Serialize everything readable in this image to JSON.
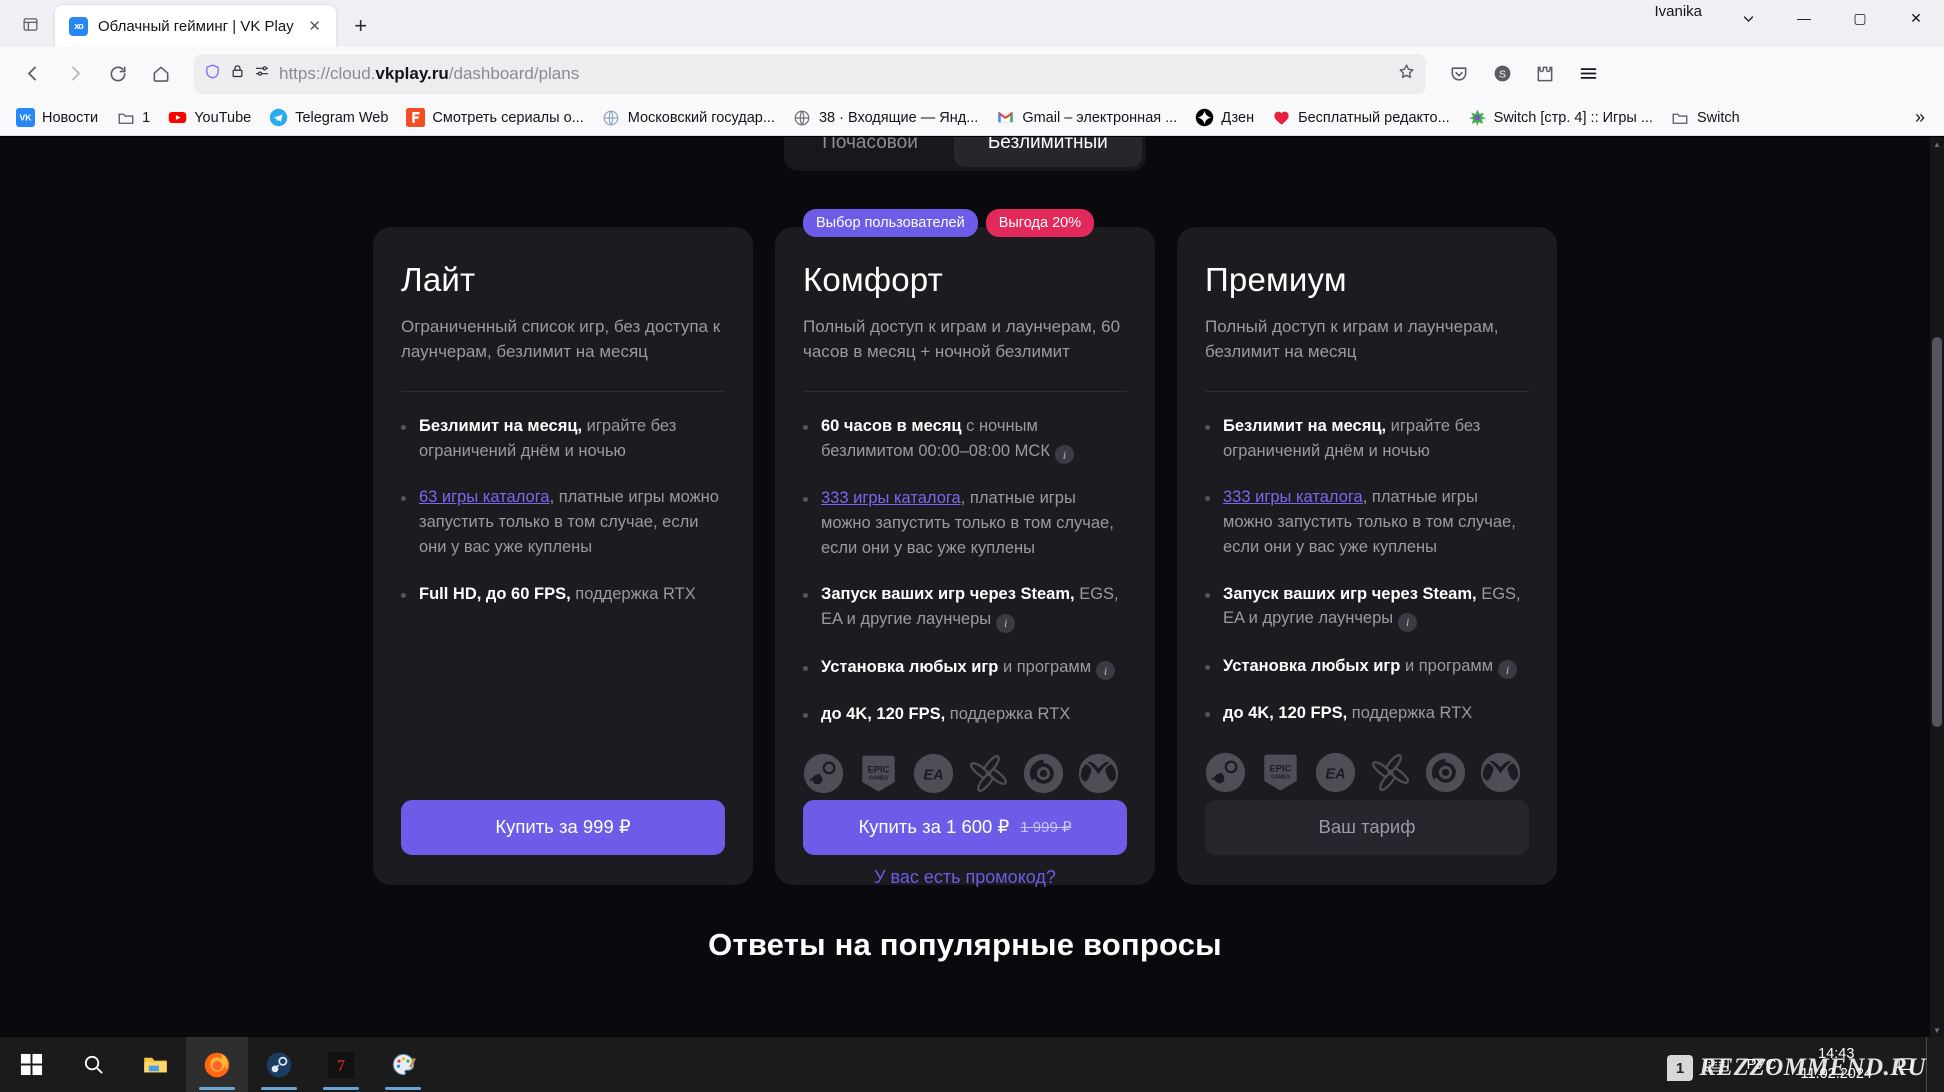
{
  "browser": {
    "tab": {
      "title": "Облачный гейминг | VK Play",
      "favicon_label": "vk",
      "close_icon": "close-icon"
    },
    "newtab_label": "+",
    "window_user": "Ivanika",
    "window_controls": {
      "minimize": "—",
      "maximize": "▢",
      "close": "✕"
    },
    "list_tabs_icon": "list-all-tabs-icon",
    "nav": {
      "back_icon": "back-arrow-icon",
      "forward_icon": "forward-arrow-icon",
      "reload_icon": "reload-icon",
      "home_icon": "home-icon",
      "shield_icon": "shield-icon",
      "lock_icon": "lock-icon",
      "permissions_icon": "page-permissions-icon",
      "bookmark_star_icon": "bookmark-star-icon",
      "pocket_icon": "pocket-icon",
      "account_icon": "account-icon",
      "extensions_icon": "extensions-icon",
      "menu_icon": "hamburger-menu-icon"
    },
    "url": {
      "scheme": "https://cloud.",
      "domain": "vkplay.ru",
      "path": "/dashboard/plans"
    },
    "bookmarks": [
      {
        "label": "Новости",
        "icon": "vk-icon",
        "color": "#2787f5"
      },
      {
        "label": "1",
        "icon": "folder-icon",
        "color": "#5b5b66"
      },
      {
        "label": "YouTube",
        "icon": "youtube-icon",
        "color": "#ff0000"
      },
      {
        "label": "Telegram Web",
        "icon": "telegram-icon",
        "color": "#2aabee"
      },
      {
        "label": "Смотреть сериалы о...",
        "icon": "filmix-icon",
        "color": "#f04e23"
      },
      {
        "label": "Московский государ...",
        "icon": "globe-icon",
        "color": "#8fa6c0"
      },
      {
        "label": "38 · Входящие — Янд...",
        "icon": "globe-icon",
        "color": "#6f6f78"
      },
      {
        "label": "Gmail – электронная ...",
        "icon": "gmail-icon",
        "color": "#ea4335"
      },
      {
        "label": "Дзен",
        "icon": "dzen-icon",
        "color": "#000000"
      },
      {
        "label": "Бесплатный редакто...",
        "icon": "heart-icon",
        "color": "#e8213f"
      },
      {
        "label": "Switch [стр. 4] :: Игры ...",
        "icon": "switch-icon",
        "color": "#46b04a"
      },
      {
        "label": "Switch",
        "icon": "folder-icon",
        "color": "#5b5b66"
      }
    ],
    "bookmarks_overflow_icon": "chevron-double-right-icon"
  },
  "page": {
    "billing_tabs": [
      {
        "label": "Почасовой",
        "active": false
      },
      {
        "label": "Безлимитный",
        "active": true
      }
    ],
    "promo_link": "У вас есть промокод?",
    "faq_heading": "Ответы на популярные вопросы",
    "colors": {
      "accent": "#6c5ce7",
      "badge_sale": "#e3285a",
      "card_bg": "#1b1b20",
      "page_bg": "#0a0a0e"
    },
    "launcher_icons": [
      "steam-icon",
      "epic-games-icon",
      "ea-icon",
      "battlenet-icon",
      "ubisoft-icon",
      "xbox-icon"
    ],
    "plans": [
      {
        "title": "Лайт",
        "subtitle": "Ограниченный список игр, без доступа к лаунчерам, безлимит на месяц",
        "badges": [],
        "features": [
          {
            "strong": "Безлимит на месяц,",
            "rest": " играйте без ограничений днём и ночью",
            "link": "",
            "info": false
          },
          {
            "strong": "",
            "link": "63 игры каталога",
            "rest": ", платные игры можно запустить только в том случае, если они у вас уже куплены",
            "info": false
          },
          {
            "strong": "Full HD, до 60 FPS,",
            "rest": " поддержка RTX",
            "link": "",
            "info": false
          }
        ],
        "has_launchers": false,
        "cta": {
          "label": "Купить за 999 ₽",
          "old_price": "",
          "style": "primary"
        }
      },
      {
        "title": "Комфорт",
        "subtitle": "Полный доступ к играм и лаунчерам, 60 часов в месяц + ночной безлимит",
        "badges": [
          {
            "label": "Выбор пользователей",
            "color": "#6c5ce7"
          },
          {
            "label": "Выгода 20%",
            "color": "#e3285a"
          }
        ],
        "features": [
          {
            "strong": "60 часов в месяц",
            "rest": " с ночным безлимитом 00:00–08:00 МСК",
            "link": "",
            "info": true
          },
          {
            "strong": "",
            "link": "333 игры каталога",
            "rest": ", платные игры можно запустить только в том случае, если они у вас уже куплены",
            "info": false
          },
          {
            "strong": "Запуск ваших игр через Steam,",
            "rest": " EGS, EA и другие лаунчеры",
            "link": "",
            "info": true
          },
          {
            "strong": "Установка любых игр",
            "rest": " и программ",
            "link": "",
            "info": true
          },
          {
            "strong": "до 4K, 120 FPS,",
            "rest": " поддержка RTX",
            "link": "",
            "info": false
          }
        ],
        "has_launchers": true,
        "cta": {
          "label": "Купить за 1 600 ₽",
          "old_price": "1 999 ₽",
          "style": "primary"
        }
      },
      {
        "title": "Премиум",
        "subtitle": "Полный доступ к играм и лаунчерам, безлимит на месяц",
        "badges": [],
        "features": [
          {
            "strong": "Безлимит на месяц,",
            "rest": " играйте без ограничений днём и ночью",
            "link": "",
            "info": false
          },
          {
            "strong": "",
            "link": "333 игры каталога",
            "rest": ", платные игры можно запустить только в том случае, если они у вас уже куплены",
            "info": false
          },
          {
            "strong": "Запуск ваших игр через Steam,",
            "rest": " EGS, EA и другие лаунчеры",
            "link": "",
            "info": true
          },
          {
            "strong": "Установка любых игр",
            "rest": " и программ",
            "link": "",
            "info": true
          },
          {
            "strong": "до 4K, 120 FPS,",
            "rest": " поддержка RTX",
            "link": "",
            "info": false
          }
        ],
        "has_launchers": true,
        "cta": {
          "label": "Ваш тариф",
          "old_price": "",
          "style": "disabled"
        }
      }
    ]
  },
  "taskbar": {
    "items": [
      {
        "name": "start-button",
        "icon": "windows-logo-icon",
        "state": "idle"
      },
      {
        "name": "search-button",
        "icon": "search-icon",
        "state": "idle"
      },
      {
        "name": "file-explorer",
        "icon": "folder-icon",
        "state": "idle"
      },
      {
        "name": "firefox",
        "icon": "firefox-icon",
        "state": "active"
      },
      {
        "name": "steam",
        "icon": "steam-icon",
        "state": "running"
      },
      {
        "name": "seven-days-to-die",
        "icon": "game-icon",
        "state": "running"
      },
      {
        "name": "paint",
        "icon": "paint-icon",
        "state": "running"
      }
    ],
    "tray": {
      "chevron_icon": "show-hidden-icons-icon",
      "keyboard_icon": "touch-keyboard-icon",
      "language": "РУС",
      "time": "14:43",
      "date": "11.02.2024",
      "notification_icon": "action-center-icon"
    }
  },
  "watermark": {
    "text": "REZZOMMEND.RU",
    "badge": "1"
  }
}
